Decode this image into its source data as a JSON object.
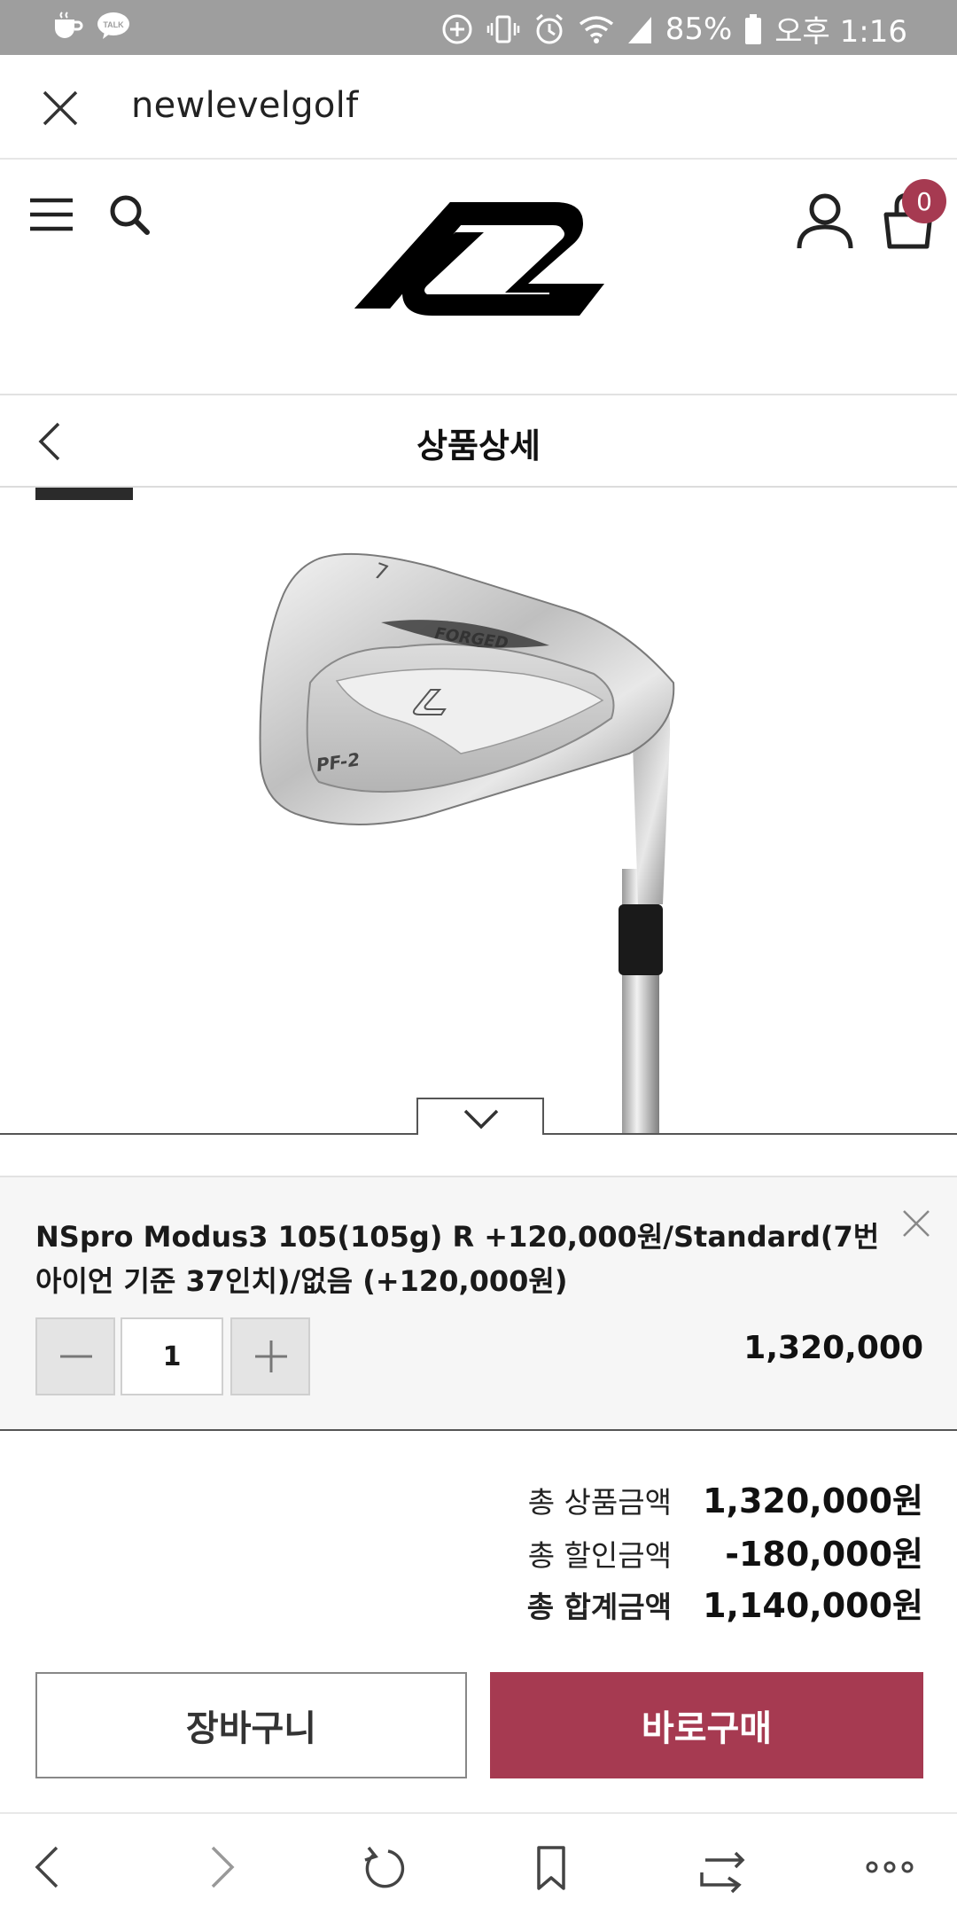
{
  "status_bar": {
    "battery": "85%",
    "time": "오후 1:16",
    "notification_icons": [
      "coffee-icon",
      "kakaotalk-icon"
    ],
    "status_icons": [
      "data-saver-icon",
      "vibrate-icon",
      "alarm-icon",
      "wifi-icon",
      "signal-icon",
      "battery-icon"
    ]
  },
  "browser": {
    "url_title": "newlevelgolf"
  },
  "header": {
    "cart_count": "0",
    "brand_color": "#a63a51"
  },
  "page": {
    "title": "상품상세"
  },
  "product": {
    "image_alt": "PF-2 forged iron head",
    "head_text": [
      "FORGED",
      "PF-2",
      "7"
    ]
  },
  "option": {
    "description": "NSpro Modus3 105(105g) R +120,000원/Standard(7번 아이언 기준 37인치)/없음 (+120,000원)",
    "quantity": "1",
    "price": "1,320,000"
  },
  "totals": [
    {
      "label": "총 상품금액",
      "value": "1,320,000원"
    },
    {
      "label": "총 할인금액",
      "value": "-180,000원"
    },
    {
      "label": "총 합계금액",
      "value": "1,140,000원"
    }
  ],
  "buttons": {
    "cart": "장바구니",
    "buy": "바로구매"
  },
  "bottom_nav": [
    "back-icon",
    "forward-icon",
    "refresh-icon",
    "bookmark-icon",
    "tabs-icon",
    "more-icon"
  ]
}
